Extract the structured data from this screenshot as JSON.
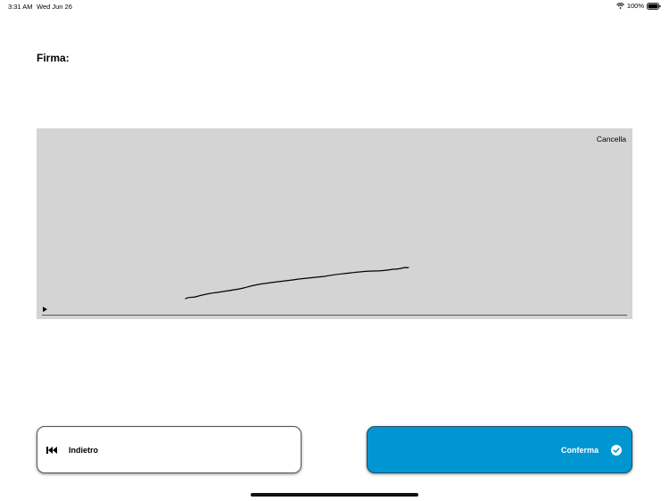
{
  "status_bar": {
    "time": "3:31 AM",
    "date": "Wed Jun 26",
    "battery_percent": "100%",
    "battery_level": 1.0,
    "icons": [
      "wifi-icon",
      "battery-icon"
    ]
  },
  "page": {
    "title": "Firma:"
  },
  "signature_pad": {
    "clear_label": "Cancella",
    "background_color": "#d4d4d4",
    "stroke_color": "#000000",
    "icons": [
      "play-icon"
    ]
  },
  "buttons": {
    "back_label": "Indietro",
    "back_icon": "rewind-icon",
    "confirm_label": "Conferma",
    "confirm_icon": "check-circle-icon",
    "confirm_color": "#0096d1"
  }
}
